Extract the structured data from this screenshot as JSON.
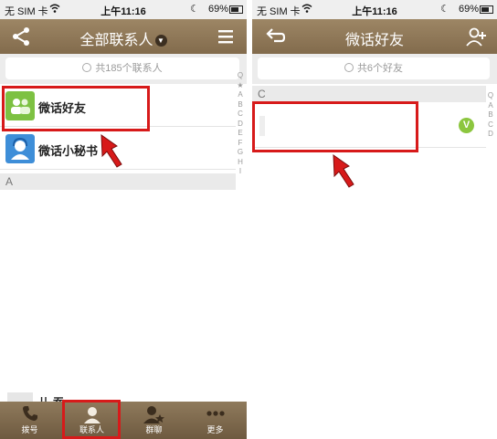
{
  "status_left": {
    "carrier": "无 SIM 卡",
    "time": "上午11:16",
    "battery": "69%"
  },
  "status_right": {
    "carrier": "无 SIM 卡",
    "time": "上午11:16",
    "battery": "69%"
  },
  "left": {
    "title": "全部联系人",
    "search_text": "共185个联系人",
    "index_letters": [
      "Q",
      "★",
      "A",
      "B",
      "C",
      "D",
      "E",
      "F",
      "G",
      "H",
      "I"
    ],
    "rows": [
      {
        "label": "微话好友"
      },
      {
        "label": "微话小秘书"
      }
    ],
    "section_header": "A",
    "partial_row_text": "儿·吞",
    "tabs": [
      {
        "label": "拨号"
      },
      {
        "label": "联系人"
      },
      {
        "label": "群聊"
      },
      {
        "label": "更多"
      }
    ]
  },
  "right": {
    "title": "微话好友",
    "search_text": "共6个好友",
    "section_header": "C",
    "badge": "V",
    "index_letters": [
      "Q",
      "A",
      "B",
      "C",
      "D"
    ]
  },
  "colors": {
    "navbar": "#8f7a5a",
    "highlight": "#d71a1a",
    "badge": "#8cc63f",
    "secretary_avatar": "#3e8ed8",
    "friends_avatar": "#7dc142"
  }
}
